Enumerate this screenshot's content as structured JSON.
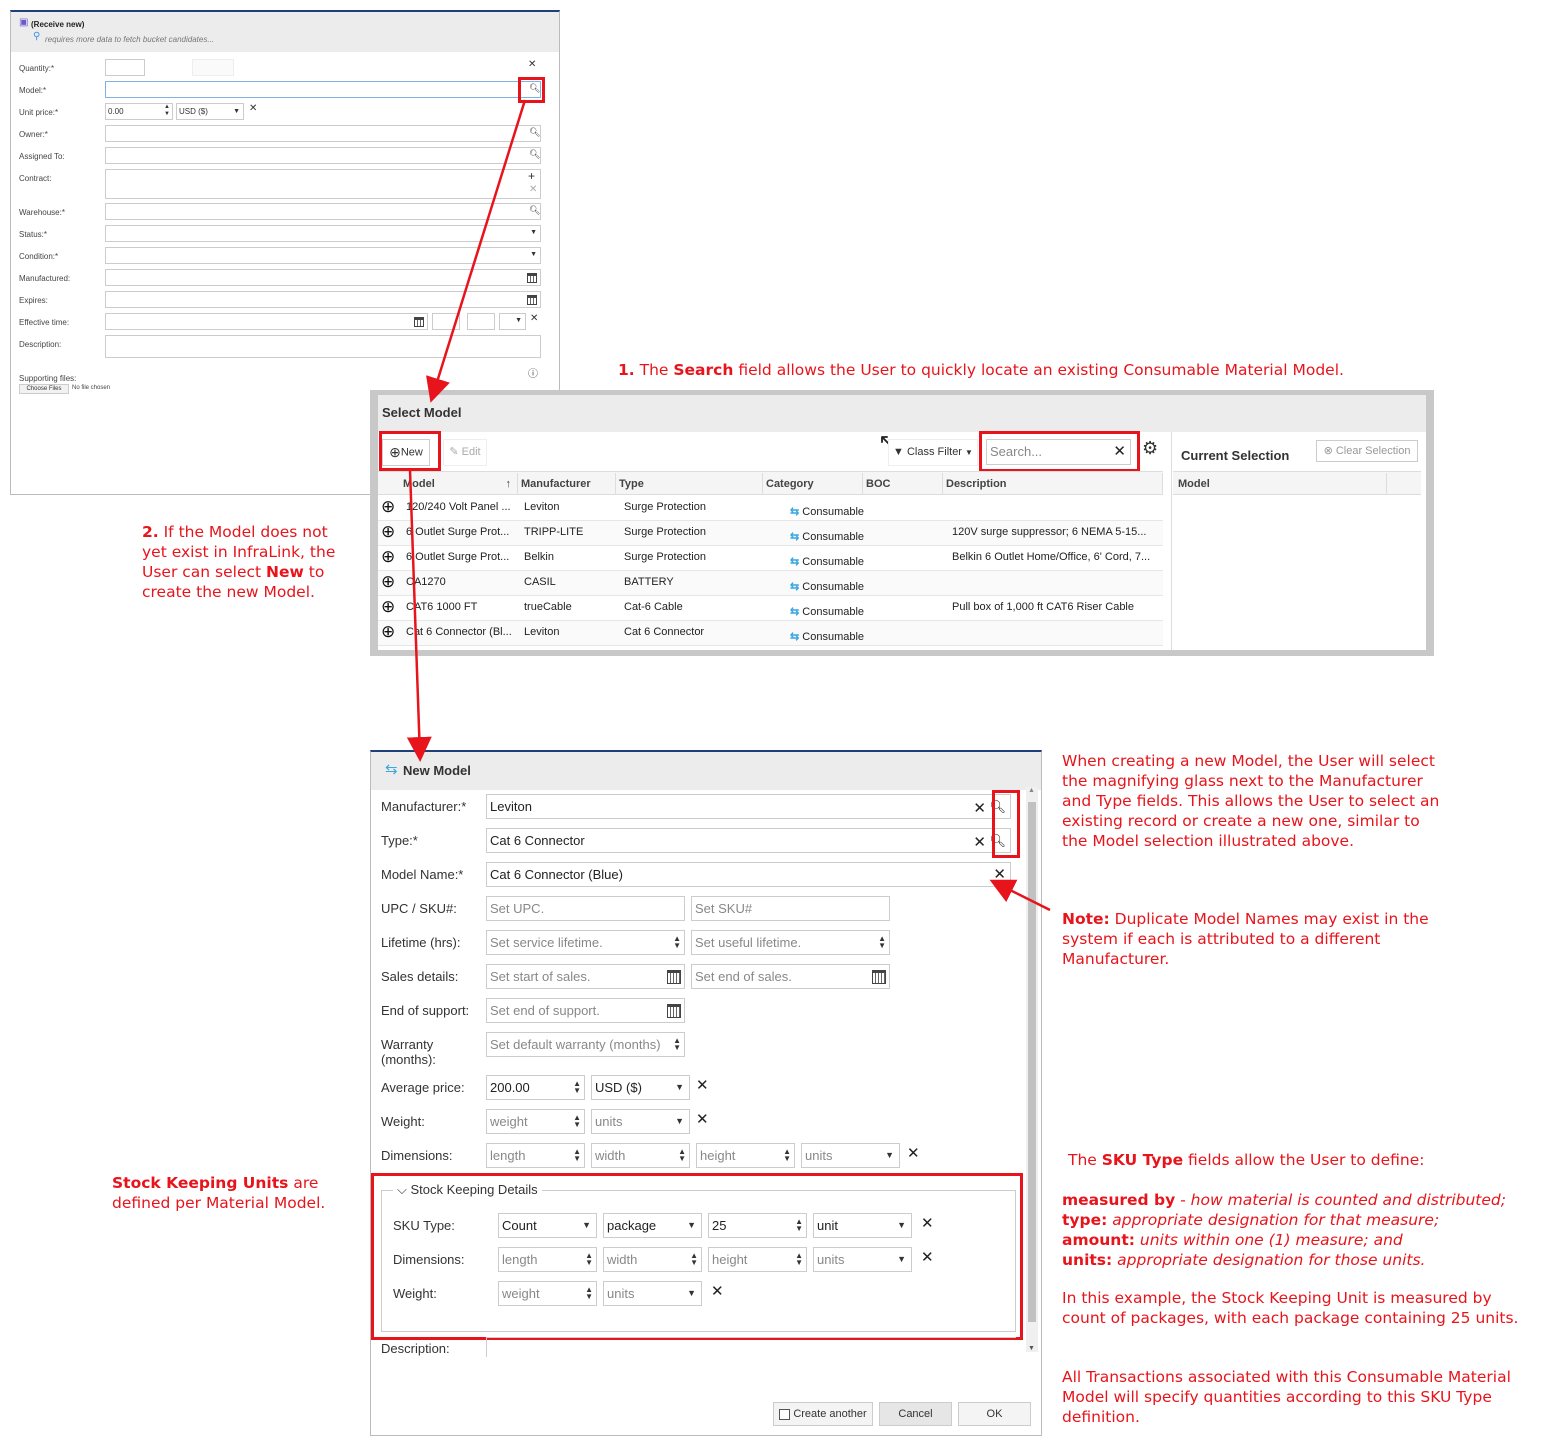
{
  "receive_dialog": {
    "title": "(Receive new)",
    "hint": "requires more data to fetch bucket candidates...",
    "labels": {
      "quantity": "Quantity:*",
      "model": "Model:*",
      "unit_price": "Unit price:*",
      "owner": "Owner:*",
      "assigned_to": "Assigned To:",
      "contract": "Contract:",
      "warehouse": "Warehouse:*",
      "status": "Status:*",
      "condition": "Condition:*",
      "manufactured": "Manufactured:",
      "expires": "Expires:",
      "effective_time": "Effective time:",
      "description": "Description:",
      "supporting_files": "Supporting files:"
    },
    "unit_price_value": "0.00",
    "currency": "USD ($)",
    "choose_files": "Choose Files",
    "no_file": "No file chosen"
  },
  "select_model": {
    "title": "Select Model",
    "new_label": "New",
    "edit_label": "Edit",
    "class_filter": "Class Filter",
    "search_placeholder": "Search...",
    "columns": [
      "Model",
      "Manufacturer",
      "Type",
      "Category",
      "BOC",
      "Description"
    ],
    "rows": [
      {
        "model": "120/240 Volt Panel ...",
        "manufacturer": "Leviton",
        "type": "Surge Protection",
        "category": "Consumable",
        "boc": "",
        "description": ""
      },
      {
        "model": "6 Outlet Surge Prot...",
        "manufacturer": "TRIPP-LITE",
        "type": "Surge Protection",
        "category": "Consumable",
        "boc": "",
        "description": "120V surge suppressor; 6 NEMA 5-15..."
      },
      {
        "model": "6 Outlet Surge Prot...",
        "manufacturer": "Belkin",
        "type": "Surge Protection",
        "category": "Consumable",
        "boc": "",
        "description": "Belkin 6 Outlet Home/Office, 6' Cord, 7..."
      },
      {
        "model": "CA1270",
        "manufacturer": "CASIL",
        "type": "BATTERY",
        "category": "Consumable",
        "boc": "",
        "description": ""
      },
      {
        "model": "CAT6 1000 FT",
        "manufacturer": "trueCable",
        "type": "Cat-6 Cable",
        "category": "Consumable",
        "boc": "",
        "description": "Pull box of 1,000 ft CAT6 Riser Cable"
      },
      {
        "model": "Cat 6 Connector (Bl...",
        "manufacturer": "Leviton",
        "type": "Cat 6 Connector",
        "category": "Consumable",
        "boc": "",
        "description": ""
      }
    ],
    "current_selection": "Current Selection",
    "clear_selection": "Clear Selection",
    "selection_column": "Model"
  },
  "new_model": {
    "title": "New Model",
    "labels": {
      "manufacturer": "Manufacturer:*",
      "type": "Type:*",
      "model_name": "Model Name:*",
      "upc_sku": "UPC / SKU#:",
      "lifetime": "Lifetime (hrs):",
      "sales": "Sales details:",
      "end_support": "End of support:",
      "warranty": "Warranty",
      "warranty2": "(months):",
      "avg_price": "Average price:",
      "weight": "Weight:",
      "dimensions": "Dimensions:",
      "description": "Description:"
    },
    "manufacturer": "Leviton",
    "type": "Cat 6 Connector",
    "model_name": "Cat 6 Connector (Blue)",
    "placeholders": {
      "upc": "Set UPC.",
      "sku": "Set SKU#",
      "service_lifetime": "Set service lifetime.",
      "useful_lifetime": "Set useful lifetime.",
      "start_sales": "Set start of sales.",
      "end_sales": "Set end of sales.",
      "end_support": "Set end of support.",
      "warranty": "Set default warranty (months)",
      "weight": "weight",
      "units": "units",
      "length": "length",
      "width": "width",
      "height": "height"
    },
    "avg_price": "200.00",
    "currency": "USD ($)",
    "sku": {
      "legend": "Stock Keeping Details",
      "labels": {
        "sku_type": "SKU Type:",
        "dimensions": "Dimensions:",
        "weight": "Weight:"
      },
      "measured_by": "Count",
      "type": "package",
      "amount": "25",
      "units": "unit"
    },
    "create_another": "Create another",
    "cancel": "Cancel",
    "ok": "OK"
  },
  "annotations": {
    "a1_num": "1.",
    "a1_pre": " The ",
    "a1_bold": "Search",
    "a1_post": " field allows the User to quickly locate an existing Consumable Material Model.",
    "a2_num": "2.",
    "a2_text": " If the Model does not yet exist in InfraLink, the User can select ",
    "a2_bold": "New",
    "a2_post": " to create the new Model.",
    "a3": "When creating a new Model, the User will select the magnifying glass next to the Manufacturer and Type fields. This allows the User to select an existing record or create a new one, similar to the Model selection illustrated above.",
    "a4_bold": "Note:",
    "a4_text": " Duplicate Model Names may exist in the system if each is attributed to a different Manufacturer.",
    "a5_bold": "Stock Keeping Units",
    "a5_text": " are defined per Material Model.",
    "a6_pre": "The ",
    "a6_bold": "SKU Type",
    "a6_post": " fields allow the User to define:",
    "a7_b1": "measured by",
    "a7_t1": " - how material is counted and distributed;",
    "a7_b2": "type:",
    "a7_t2": " appropriate designation for that measure;",
    "a7_b3": "amount:",
    "a7_t3": " units within one (1) measure; and",
    "a7_b4": "units:",
    "a7_t4": " appropriate designation for those units.",
    "a8": "In this example, the Stock Keeping Unit is measured by count of packages, with each package containing 25 units.",
    "a9": "All Transactions associated with this Consumable Material Model will specify quantities according to this SKU Type definition."
  },
  "colors": {
    "annotation": "#e8141b",
    "header_bar": "#1f3f7a",
    "consumable_icon": "#3aa7e0"
  }
}
